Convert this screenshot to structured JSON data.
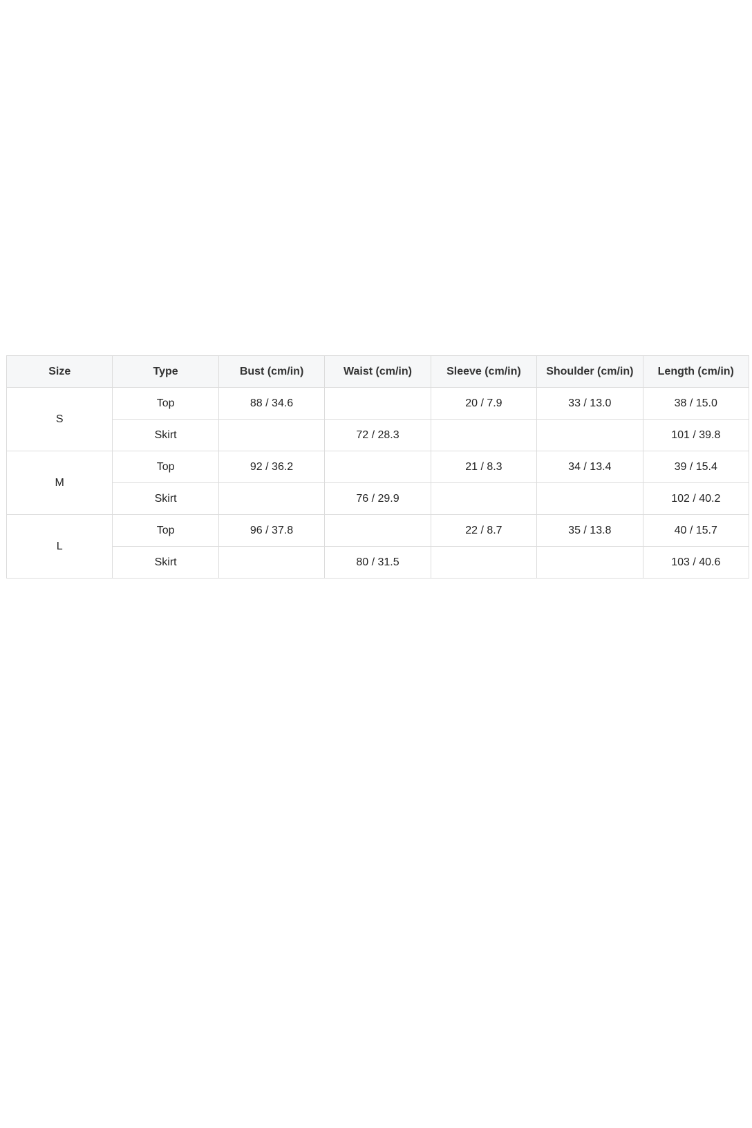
{
  "table": {
    "headers": [
      "Size",
      "Type",
      "Bust (cm/in)",
      "Waist (cm/in)",
      "Sleeve (cm/in)",
      "Shoulder (cm/in)",
      "Length (cm/in)"
    ],
    "groups": [
      {
        "size": "S",
        "rows": [
          {
            "type": "Top",
            "bust": "88 / 34.6",
            "waist": "",
            "sleeve": "20 / 7.9",
            "shoulder": "33 / 13.0",
            "length": "38 / 15.0"
          },
          {
            "type": "Skirt",
            "bust": "",
            "waist": "72 / 28.3",
            "sleeve": "",
            "shoulder": "",
            "length": "101 / 39.8"
          }
        ]
      },
      {
        "size": "M",
        "rows": [
          {
            "type": "Top",
            "bust": "92 / 36.2",
            "waist": "",
            "sleeve": "21 / 8.3",
            "shoulder": "34 / 13.4",
            "length": "39 / 15.4"
          },
          {
            "type": "Skirt",
            "bust": "",
            "waist": "76 / 29.9",
            "sleeve": "",
            "shoulder": "",
            "length": "102 / 40.2"
          }
        ]
      },
      {
        "size": "L",
        "rows": [
          {
            "type": "Top",
            "bust": "96 / 37.8",
            "waist": "",
            "sleeve": "22 / 8.7",
            "shoulder": "35 / 13.8",
            "length": "40 / 15.7"
          },
          {
            "type": "Skirt",
            "bust": "",
            "waist": "80 / 31.5",
            "sleeve": "",
            "shoulder": "",
            "length": "103 / 40.6"
          }
        ]
      }
    ]
  },
  "colors": {
    "header_background": "#f6f7f8",
    "border": "#dcdcdc",
    "text": "#222222"
  }
}
